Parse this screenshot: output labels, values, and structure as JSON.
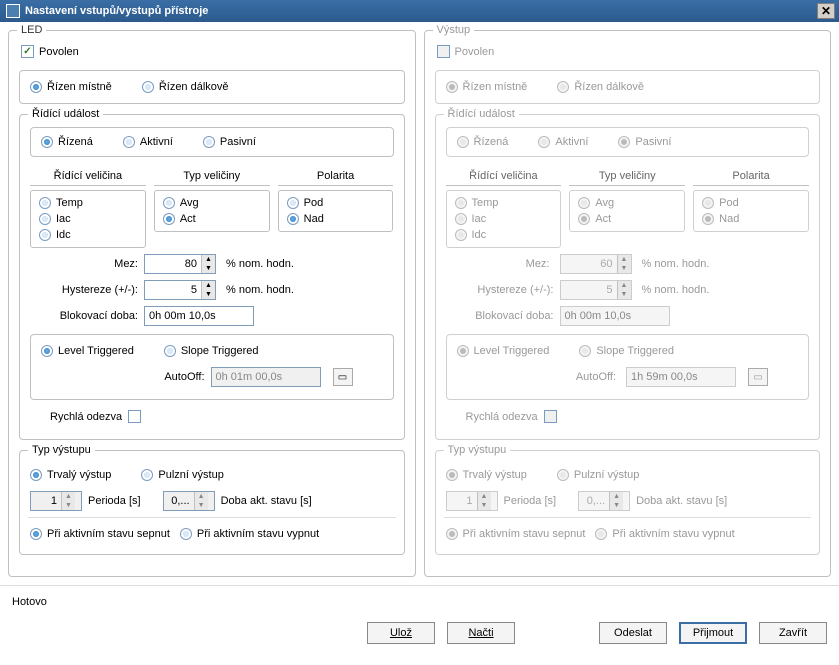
{
  "window": {
    "title": "Nastavení vstupů/vystupů přístroje"
  },
  "left": {
    "title": "LED",
    "enabled_label": "Povolen",
    "enabled": true,
    "control_local": "Řízen místně",
    "control_remote": "Řízen dálkově",
    "event_group": "Řídící událost",
    "mode_driven": "Řízená",
    "mode_active": "Aktivní",
    "mode_passive": "Pasivní",
    "col_qty": "Řídící veličina",
    "col_type": "Typ veličiny",
    "col_polarity": "Polarita",
    "qty_temp": "Temp",
    "qty_iac": "Iac",
    "qty_idc": "Idc",
    "type_avg": "Avg",
    "type_act": "Act",
    "pol_pod": "Pod",
    "pol_nad": "Nad",
    "mez_label": "Mez:",
    "mez_value": "80",
    "mez_unit": "% nom. hodn.",
    "hyst_label": "Hystereze (+/-):",
    "hyst_value": "5",
    "hyst_unit": "% nom. hodn.",
    "block_label": "Blokovací doba:",
    "block_value": "0h 00m 10,0s",
    "trig_level": "Level Triggered",
    "trig_slope": "Slope Triggered",
    "autooff_label": "AutoOff:",
    "autooff_value": "0h 01m 00,0s",
    "fast_label": "Rychlá odezva",
    "out_group": "Typ výstupu",
    "out_perm": "Trvalý výstup",
    "out_pulse": "Pulzní výstup",
    "period_value": "1",
    "period_label": "Perioda [s]",
    "active_value": "0,...",
    "active_label": "Doba akt. stavu [s]",
    "on_active_on": "Při aktivním stavu sepnut",
    "on_active_off": "Při aktivním stavu vypnut"
  },
  "right": {
    "title": "Výstup",
    "enabled_label": "Povolen",
    "enabled": false,
    "control_local": "Řízen místně",
    "control_remote": "Řízen dálkově",
    "event_group": "Řídící událost",
    "mode_driven": "Řízená",
    "mode_active": "Aktivní",
    "mode_passive": "Pasivní",
    "col_qty": "Řídící veličina",
    "col_type": "Typ veličiny",
    "col_polarity": "Polarita",
    "qty_temp": "Temp",
    "qty_iac": "Iac",
    "qty_idc": "Idc",
    "type_avg": "Avg",
    "type_act": "Act",
    "pol_pod": "Pod",
    "pol_nad": "Nad",
    "mez_label": "Mez:",
    "mez_value": "60",
    "mez_unit": "% nom. hodn.",
    "hyst_label": "Hystereze (+/-):",
    "hyst_value": "5",
    "hyst_unit": "% nom. hodn.",
    "block_label": "Blokovací doba:",
    "block_value": "0h 00m 10,0s",
    "trig_level": "Level Triggered",
    "trig_slope": "Slope Triggered",
    "autooff_label": "AutoOff:",
    "autooff_value": "1h 59m 00,0s",
    "fast_label": "Rychlá odezva",
    "out_group": "Typ výstupu",
    "out_perm": "Trvalý výstup",
    "out_pulse": "Pulzní výstup",
    "period_value": "1",
    "period_label": "Perioda [s]",
    "active_value": "0,...",
    "active_label": "Doba akt. stavu [s]",
    "on_active_on": "Při aktivním stavu sepnut",
    "on_active_off": "Při aktivním stavu vypnut"
  },
  "footer": {
    "status": "Hotovo",
    "save": "Ulož",
    "load": "Načti",
    "send": "Odeslat",
    "accept": "Přijmout",
    "close": "Zavřít"
  }
}
